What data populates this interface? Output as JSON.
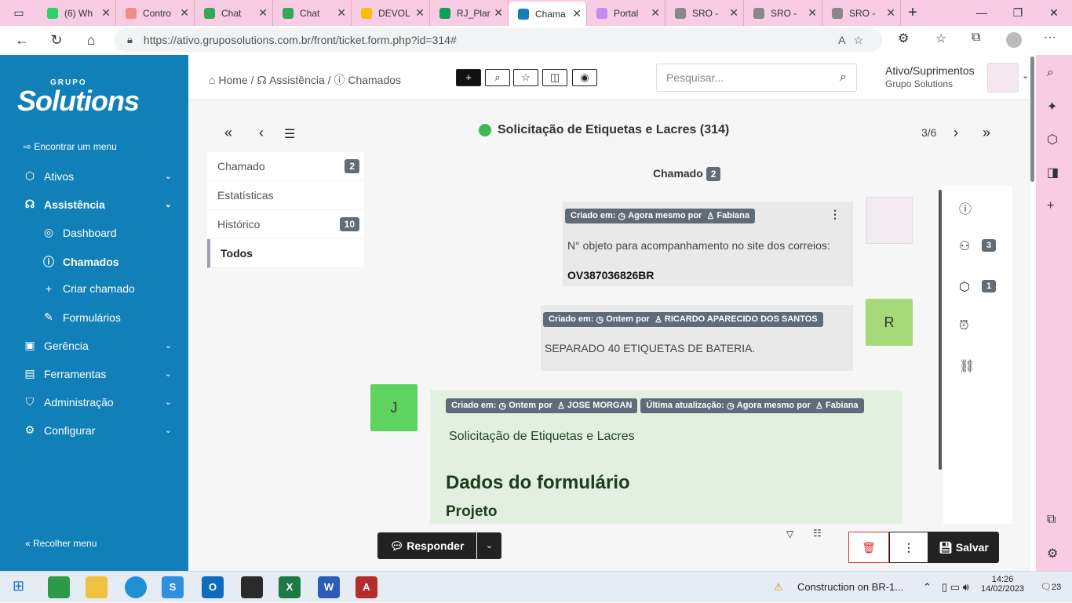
{
  "browser": {
    "tabs": [
      {
        "label": "(6) Wh",
        "color": "#25d366"
      },
      {
        "label": "Contro",
        "color": "#f28b82"
      },
      {
        "label": "Chat",
        "color": "#34a853"
      },
      {
        "label": "Chat",
        "color": "#34a853"
      },
      {
        "label": "DEVOL",
        "color": "#fbbc04"
      },
      {
        "label": "RJ_Plar",
        "color": "#0f9d58"
      },
      {
        "label": "Chama",
        "color": "#1180b8"
      },
      {
        "label": "Portal",
        "color": "#c58af9"
      },
      {
        "label": "SRO -",
        "color": "#888888"
      },
      {
        "label": "SRO -",
        "color": "#888888"
      },
      {
        "label": "SRO -",
        "color": "#888888"
      }
    ],
    "url": "https://ativo.gruposolutions.com.br/front/ticket.form.php?id=314#"
  },
  "sidebar": {
    "logo_small": "GRUPO",
    "logo_big": "Solutions",
    "find_menu": "Encontrar um menu",
    "items": [
      {
        "label": "Ativos",
        "icon": "box-icon"
      },
      {
        "label": "Assistência",
        "icon": "headset-icon"
      },
      {
        "label": "Dashboard",
        "icon": "gauge-icon"
      },
      {
        "label": "Chamados",
        "icon": "alert-circle-icon"
      },
      {
        "label": "Criar chamado",
        "icon": "plus-icon"
      },
      {
        "label": "Formulários",
        "icon": "edit-icon"
      },
      {
        "label": "Gerência",
        "icon": "wallet-icon"
      },
      {
        "label": "Ferramentas",
        "icon": "briefcase-icon"
      },
      {
        "label": "Administração",
        "icon": "shield-icon"
      },
      {
        "label": "Configurar",
        "icon": "gear-icon"
      }
    ],
    "collapse": "Recolher menu"
  },
  "header": {
    "crumbs": [
      "Home",
      "Assistência",
      "Chamados"
    ],
    "search_placeholder": "Pesquisar...",
    "user_entity": "Ativo/Suprimentos",
    "user_group": "Grupo Solutions"
  },
  "ticket": {
    "title": "Solicitação de Etiquetas e Lacres (314)",
    "pager": "3/6",
    "tabs": [
      {
        "label": "Chamado",
        "badge": "2"
      },
      {
        "label": "Estatísticas",
        "badge": ""
      },
      {
        "label": "Histórico",
        "badge": "10"
      },
      {
        "label": "Todos",
        "badge": ""
      }
    ],
    "timeline_title": "Chamado",
    "timeline_badge": "2",
    "messages": [
      {
        "meta_created": "Criado em:",
        "meta_when": "Agora mesmo por",
        "author": "Fabiana",
        "text1": "N° objeto para acompanhamento no site dos correios:",
        "text2": "OV387036826BR"
      },
      {
        "meta_created": "Criado em:",
        "meta_when": "Ontem por",
        "author": "RICARDO APARECIDO DOS SANTOS",
        "avatar_letter": "R",
        "text1": "SEPARADO 40 ETIQUETAS DE BATERIA."
      },
      {
        "meta_created": "Criado em:",
        "meta_when": "Ontem por",
        "author": "JOSE MORGAN",
        "update_label": "Última atualização:",
        "update_when": "Agora mesmo por",
        "update_author": "Fabiana",
        "avatar_letter": "J",
        "text1": "Solicitação de Etiquetas e Lacres",
        "heading": "Dados do formulário",
        "subheading": "Projeto"
      }
    ],
    "right_badges": {
      "actors": "3",
      "items": "1"
    },
    "reply": "Responder",
    "save": "Salvar"
  },
  "taskbar": {
    "weather": "Construction on BR-1...",
    "time": "14:26",
    "date": "14/02/2023",
    "notif": "23"
  }
}
